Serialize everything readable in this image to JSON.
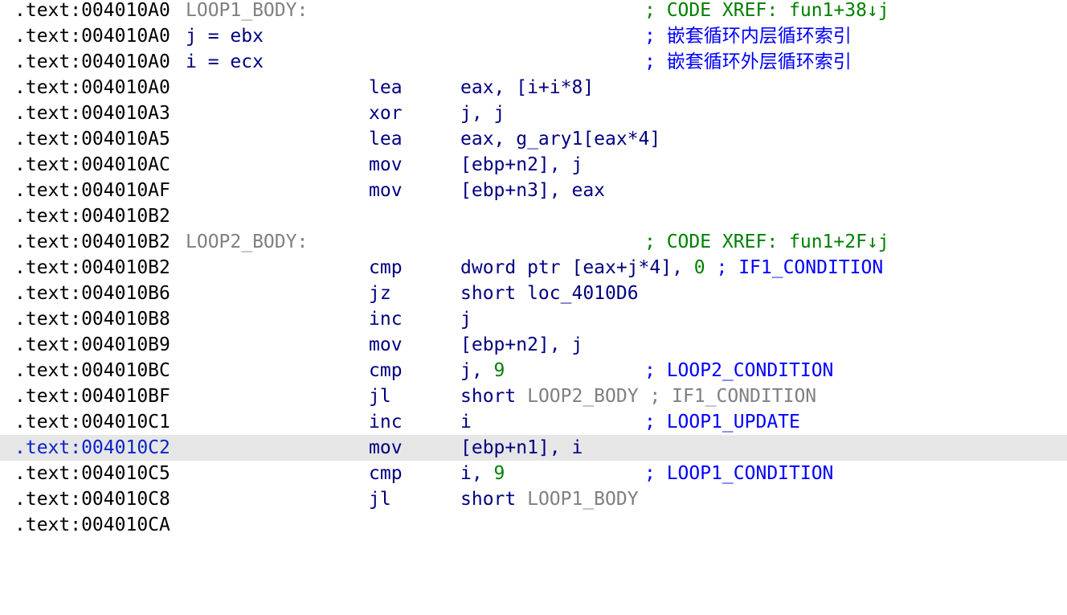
{
  "lines": [
    {
      "addr": ".text:004010A0",
      "label": "LOOP1_BODY:",
      "xref": "; CODE XREF: fun1+38↓j"
    },
    {
      "addr": ".text:004010A0",
      "var": "j = ebx",
      "comment": "; 嵌套循环内层循环索引"
    },
    {
      "addr": ".text:004010A0",
      "var": "i = ecx",
      "comment": "; 嵌套循环外层循环索引"
    },
    {
      "addr": ".text:004010A0",
      "mnemonic": "lea",
      "operands": "eax, [i+i*8]"
    },
    {
      "addr": ".text:004010A3",
      "mnemonic": "xor",
      "operands": "j, j"
    },
    {
      "addr": ".text:004010A5",
      "mnemonic": "lea",
      "operands": "eax, g_ary1[eax*4]"
    },
    {
      "addr": ".text:004010AC",
      "mnemonic": "mov",
      "operands": "[ebp+n2], j"
    },
    {
      "addr": ".text:004010AF",
      "mnemonic": "mov",
      "operands": "[ebp+n3], eax"
    },
    {
      "addr": ".text:004010B2"
    },
    {
      "addr": ".text:004010B2",
      "label": "LOOP2_BODY:",
      "xref": "; CODE XREF: fun1+2F↓j"
    },
    {
      "addr": ".text:004010B2",
      "mnemonic": "cmp",
      "operands_pre": "dword ptr [eax+j*4], ",
      "operands_num": "0",
      "inline_comment": " ; IF1_CONDITION"
    },
    {
      "addr": ".text:004010B6",
      "mnemonic": "jz",
      "operands": "short loc_4010D6"
    },
    {
      "addr": ".text:004010B8",
      "mnemonic": "inc",
      "operands": "j"
    },
    {
      "addr": ".text:004010B9",
      "mnemonic": "mov",
      "operands": "[ebp+n2], j"
    },
    {
      "addr": ".text:004010BC",
      "mnemonic": "cmp",
      "operands_pre": "j, ",
      "operands_num": "9",
      "comment": "; LOOP2_CONDITION"
    },
    {
      "addr": ".text:004010BF",
      "mnemonic": "jl",
      "operands_pre": "short ",
      "operands_loc": "LOOP2_BODY",
      "inline_comment_gray": " ; IF1_CONDITION"
    },
    {
      "addr": ".text:004010C1",
      "mnemonic": "inc",
      "operands": "i",
      "comment": "; LOOP1_UPDATE"
    },
    {
      "addr": ".text:004010C2",
      "mnemonic": "mov",
      "operands": "[ebp+n1], i",
      "selected": true
    },
    {
      "addr": ".text:004010C5",
      "mnemonic": "cmp",
      "operands_pre": "i, ",
      "operands_num": "9",
      "comment": "; LOOP1_CONDITION"
    },
    {
      "addr": ".text:004010C8",
      "mnemonic": "jl",
      "operands_pre": "short ",
      "operands_loc": "LOOP1_BODY"
    },
    {
      "addr": ".text:004010CA"
    }
  ]
}
